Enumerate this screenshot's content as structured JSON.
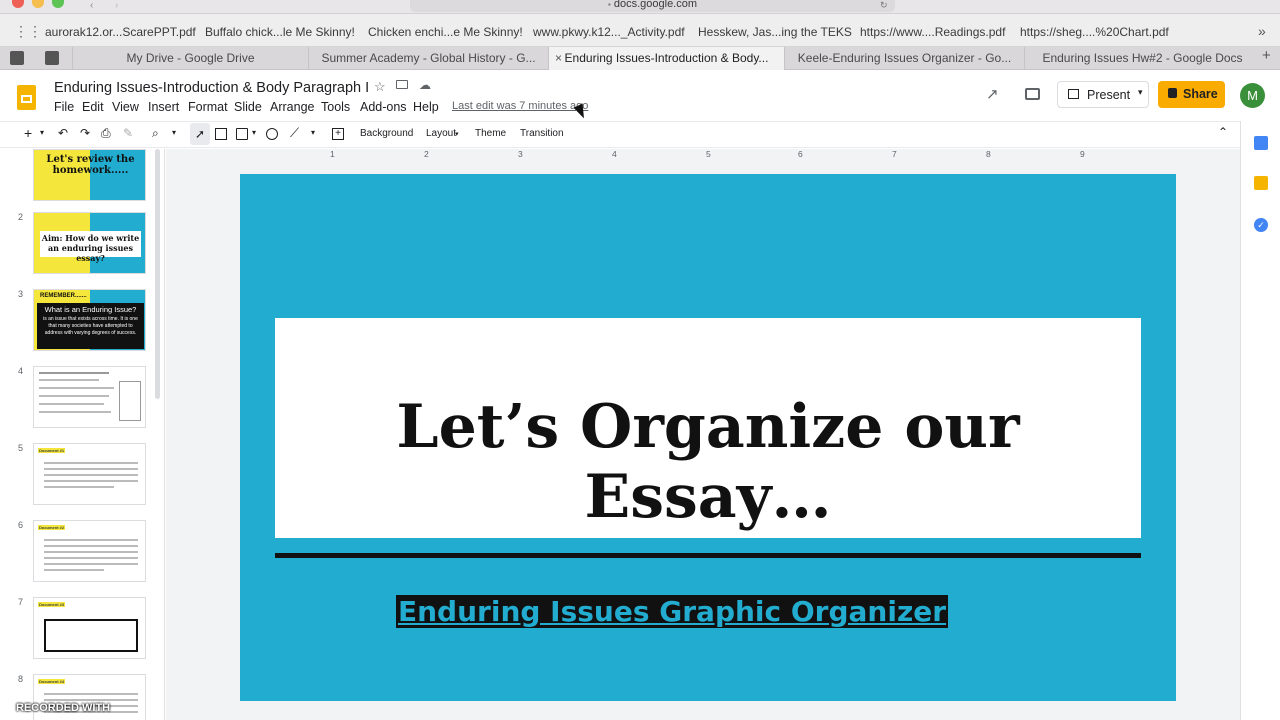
{
  "browser": {
    "url": "docs.google.com",
    "bookmarks": [
      "aurorak12.or...ScarePPT.pdf",
      "Buffalo chick...le Me Skinny!",
      "Chicken enchi...e Me Skinny!",
      "www.pkwy.k12..._Activity.pdf",
      "Hesskew, Jas...ing the TEKS",
      "https://www....Readings.pdf",
      "https://sheg....%20Chart.pdf"
    ],
    "tabs": [
      "My Drive - Google Drive",
      "Summer Academy - Global History - G...",
      "Enduring Issues-Introduction & Body...",
      "Keele-Enduring Issues Organizer - Go...",
      "Enduring Issues Hw#2 - Google Docs"
    ]
  },
  "docs": {
    "title": "Enduring Issues-Introduction & Body Paragraph I",
    "menu": [
      "File",
      "Edit",
      "View",
      "Insert",
      "Format",
      "Slide",
      "Arrange",
      "Tools",
      "Add-ons",
      "Help"
    ],
    "last_edit": "Last edit was 7 minutes ago",
    "present_label": "Present",
    "share_label": "Share",
    "avatar_letter": "M"
  },
  "toolbar": {
    "background_label": "Background",
    "layout_label": "Layout",
    "theme_label": "Theme",
    "transition_label": "Transition"
  },
  "ruler_ticks": [
    "1",
    "2",
    "3",
    "4",
    "5",
    "6",
    "7",
    "8",
    "9"
  ],
  "filmstrip": {
    "slides": [
      {
        "num": "",
        "title": "Let's review the homework....."
      },
      {
        "num": "2",
        "title": "Aim: How do we write an enduring issues essay?"
      },
      {
        "num": "3",
        "title": "REMEMBER.......",
        "subtitle": "What is an Enduring Issue?",
        "body": "is an issue that exists across time. It is one that many societies have attempted to address with varying degrees of success."
      },
      {
        "num": "4"
      },
      {
        "num": "5",
        "label": "Document #1"
      },
      {
        "num": "6",
        "label": "Document #2"
      },
      {
        "num": "7",
        "label": "Document #3"
      },
      {
        "num": "8",
        "label": "Document #4"
      }
    ]
  },
  "slide": {
    "title": "Let’s Organize our Essay…",
    "link_text": "Enduring Issues Graphic Organizer"
  },
  "overlay": {
    "recorded_text": "RECORDED WITH"
  },
  "colors": {
    "slide_bg": "#22acd0",
    "share_button": "#f9ab00",
    "thumb_yellow": "#f5e63c"
  }
}
